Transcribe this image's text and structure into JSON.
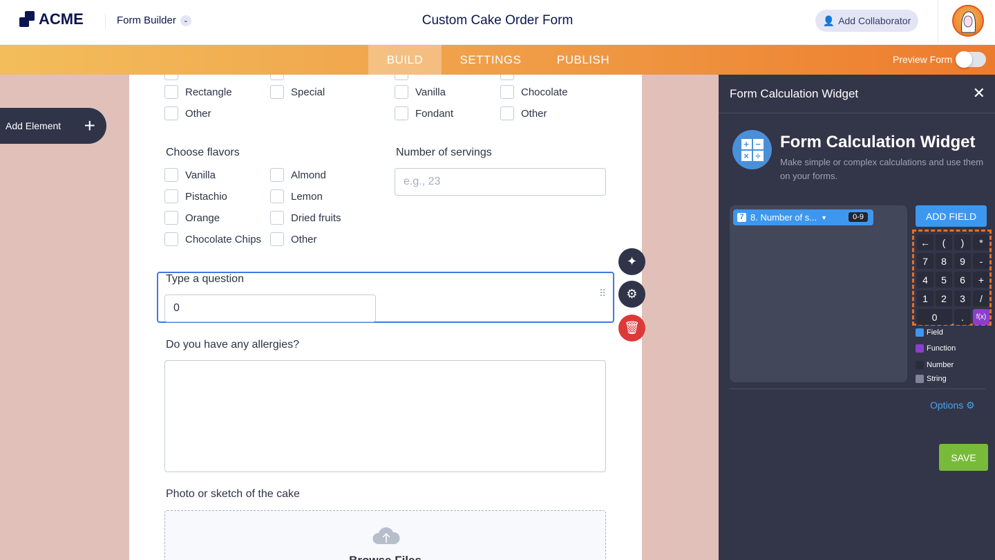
{
  "header": {
    "logo": "ACME",
    "app_menu": "Form Builder",
    "form_title": "Custom Cake Order Form",
    "add_collaborator": "Add Collaborator"
  },
  "nav": {
    "tabs": [
      "BUILD",
      "SETTINGS",
      "PUBLISH"
    ],
    "active": "BUILD",
    "preview_label": "Preview Form",
    "preview_on": false
  },
  "sidebar": {
    "add_element": "Add Element"
  },
  "form": {
    "shape_options": [
      "Rectangle",
      "Special",
      "Other"
    ],
    "frosting_options": [
      "Vanilla",
      "Chocolate",
      "Fondant",
      "Other"
    ],
    "flavors": {
      "label": "Choose flavors",
      "options": [
        "Vanilla",
        "Almond",
        "Pistachio",
        "Lemon",
        "Orange",
        "Dried fruits",
        "Chocolate Chips",
        "Other"
      ]
    },
    "servings": {
      "label": "Number of servings",
      "placeholder": "e.g., 23"
    },
    "selected_field": {
      "label": "Type a question",
      "value": "0"
    },
    "allergies": {
      "label": "Do you have any allergies?"
    },
    "photo": {
      "label": "Photo or sketch of the cake",
      "browse": "Browse Files"
    }
  },
  "panel": {
    "header": "Form Calculation Widget",
    "title": "Form Calculation Widget",
    "description": "Make simple or complex calculations and use them on your forms.",
    "field_chip": {
      "index": "7",
      "label": "8. Number of s...",
      "range": "0-9"
    },
    "add_field": "ADD FIELD",
    "keys": [
      "←",
      "(",
      ")",
      "*",
      "7",
      "8",
      "9",
      "-",
      "4",
      "5",
      "6",
      "+",
      "1",
      "2",
      "3",
      "/",
      "0",
      ".",
      "f(x)"
    ],
    "legend": [
      {
        "label": "Field",
        "color": "#3d97ef"
      },
      {
        "label": "Function",
        "color": "#8b3fcb"
      },
      {
        "label": "Number",
        "color": "#2a2c3b"
      },
      {
        "label": "String",
        "color": "#80849a"
      }
    ],
    "options": "Options",
    "save": "SAVE"
  }
}
